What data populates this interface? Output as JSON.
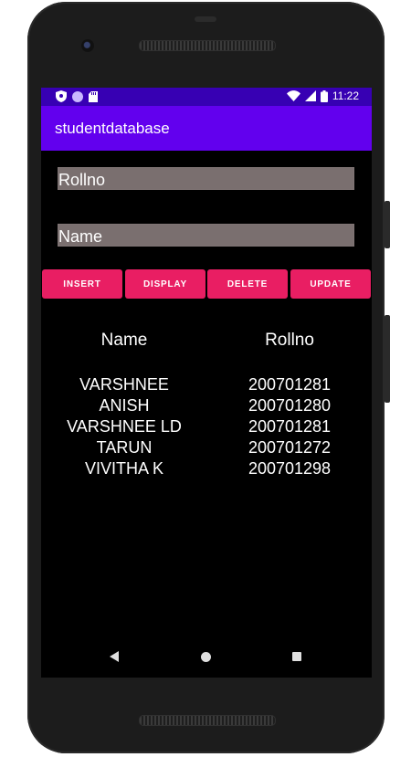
{
  "status_bar": {
    "time": "11:22",
    "left_icons": [
      "shield-icon",
      "circle-icon",
      "sd-card-icon"
    ],
    "right_icons": [
      "wifi-icon",
      "signal-icon",
      "battery-icon"
    ]
  },
  "app_bar": {
    "title": "studentdatabase"
  },
  "form": {
    "rollno_placeholder": "Rollno",
    "name_placeholder": "Name"
  },
  "buttons": {
    "insert": "INSERT",
    "display": "DISPLAY",
    "delete": "DELETE",
    "update": "UPDATE"
  },
  "table": {
    "headers": {
      "name": "Name",
      "rollno": "Rollno"
    },
    "rows": [
      {
        "name": "VARSHNEE",
        "rollno": "200701281"
      },
      {
        "name": "ANISH",
        "rollno": "200701280"
      },
      {
        "name": "VARSHNEE LD",
        "rollno": "200701281"
      },
      {
        "name": "TARUN",
        "rollno": "200701272"
      },
      {
        "name": "VIVITHA K",
        "rollno": "200701298"
      }
    ]
  },
  "colors": {
    "status_bar": "#3700b3",
    "app_bar": "#6200ee",
    "button": "#e91e63",
    "field": "#7a6f6f"
  },
  "nav_bar": {
    "icons": [
      "back-icon",
      "home-icon",
      "recents-icon"
    ]
  }
}
